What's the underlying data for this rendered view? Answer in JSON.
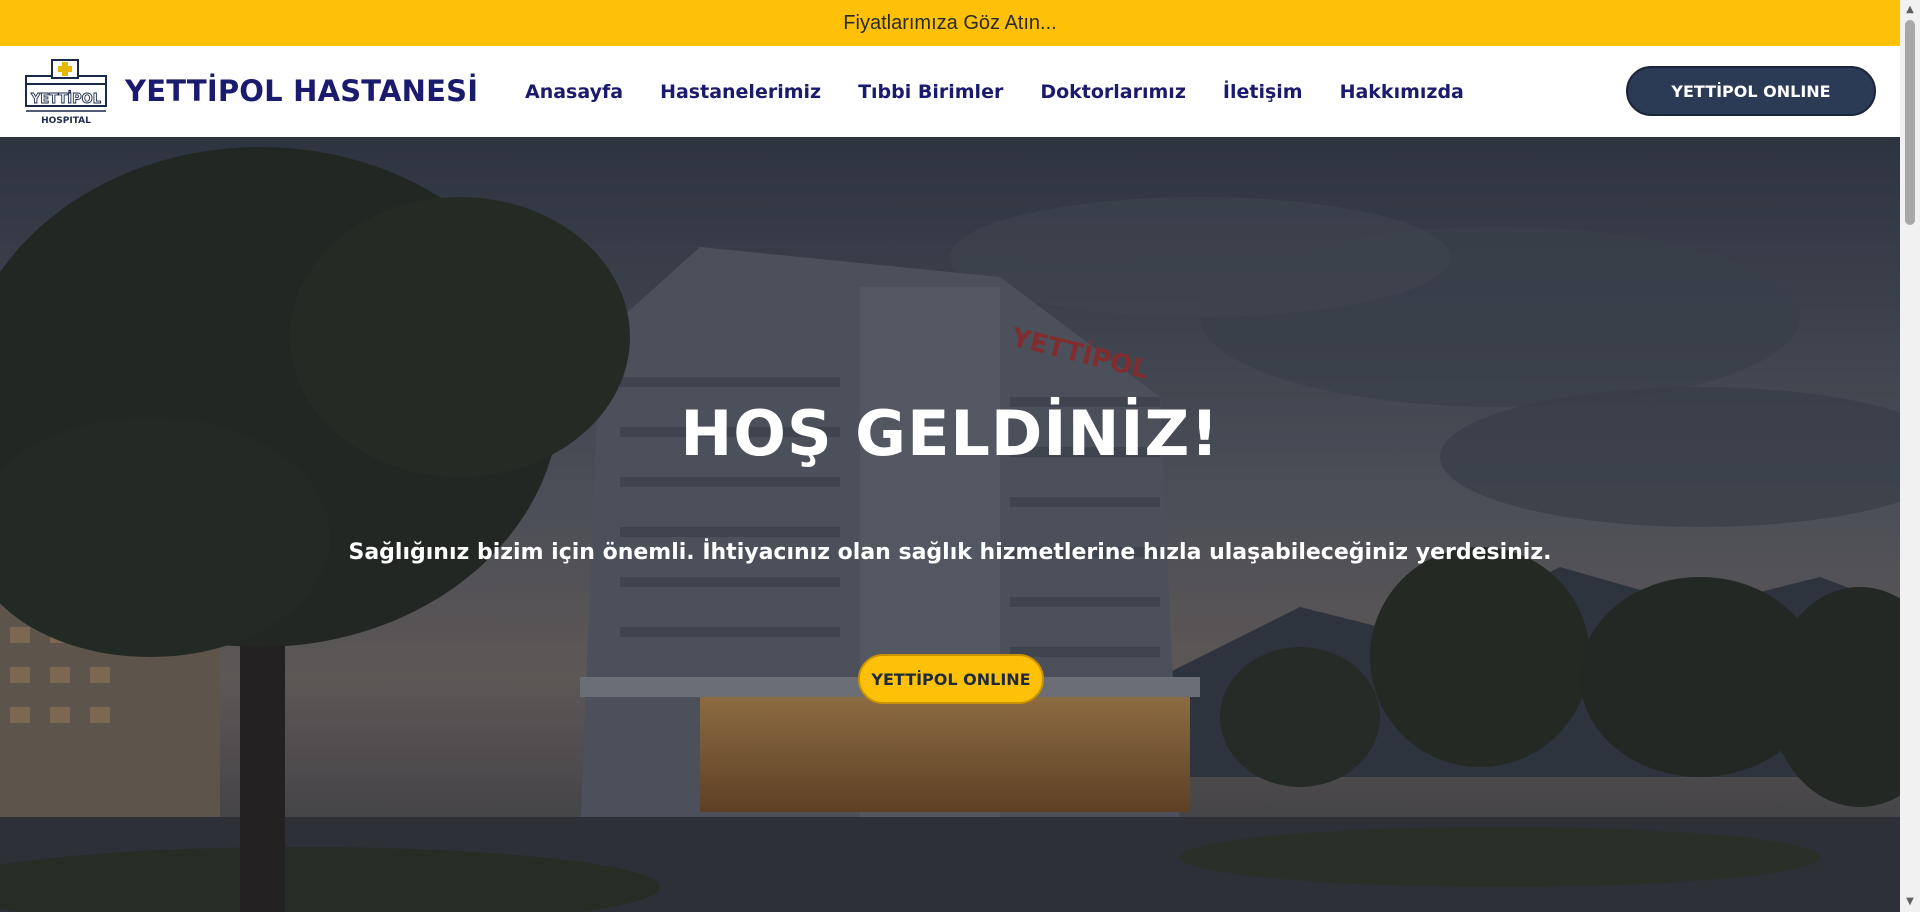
{
  "announcement": {
    "text": "Fiyatlarımıza Göz Atın..."
  },
  "header": {
    "logo": {
      "text_main": "YETTİPOL",
      "text_sub": "HOSPITAL"
    },
    "brand": "YETTİPOL HASTANESİ",
    "nav": [
      {
        "label": "Anasayfa"
      },
      {
        "label": "Hastanelerimiz"
      },
      {
        "label": "Tıbbi Birimler"
      },
      {
        "label": "Doktorlarımız"
      },
      {
        "label": "İletişim"
      },
      {
        "label": "Hakkımızda"
      }
    ],
    "online_button": "YETTİPOL ONLINE"
  },
  "hero": {
    "title": "HOŞ GELDİNİZ!",
    "subtitle": "Sağlığınız bizim için önemli. İhtiyacınız olan sağlık hizmetlerine hızla ulaşabileceğiniz yerdesiniz.",
    "button": "YETTİPOL ONLINE",
    "building_sign": "YETTİPOL"
  },
  "colors": {
    "accent": "#ffc107",
    "brand": "#1a1a6e",
    "button_dark": "#2b3a55"
  },
  "scrollbar": {
    "up_icon": "chevron-up-icon",
    "down_icon": "chevron-down-icon"
  }
}
